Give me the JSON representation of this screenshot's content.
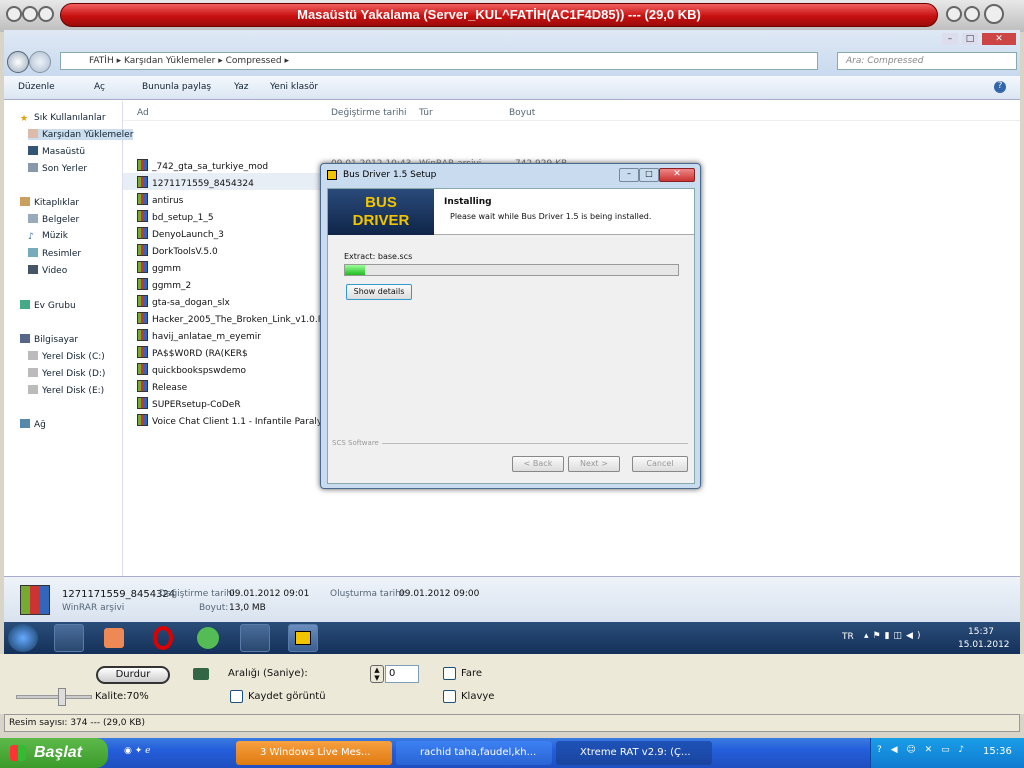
{
  "window": {
    "title": "Masaüstü Yakalama (Server_KUL^FATİH(AC1F4D85)) --- (29,0 KB)"
  },
  "explorer": {
    "breadcrumb": [
      "FATİH",
      "Karşıdan Yüklemeler",
      "Compressed"
    ],
    "search_placeholder": "Ara: Compressed",
    "toolbar": [
      "Düzenle",
      "Aç",
      "Bununla paylaş",
      "Yaz",
      "Yeni klasör"
    ],
    "sidebar": {
      "favorites_header": "Sık Kullanılanlar",
      "favorites": [
        "Karşıdan Yüklemeler",
        "Masaüstü",
        "Son Yerler"
      ],
      "libraries_header": "Kitaplıklar",
      "libraries": [
        "Belgeler",
        "Müzik",
        "Resimler",
        "Video"
      ],
      "homegroup": "Ev Grubu",
      "computer_header": "Bilgisayar",
      "drives": [
        "Yerel Disk (C:)",
        "Yerel Disk (D:)",
        "Yerel Disk (E:)"
      ],
      "network": "Ağ"
    },
    "columns": [
      "Ad",
      "Değiştirme tarihi",
      "Tür",
      "Boyut"
    ],
    "files": [
      {
        "name": "_742_gta_sa_turkiye_mod",
        "date": "09.01.2012 10:43",
        "type": "WinRAR arşivi",
        "size": "742.929 KB"
      },
      {
        "name": "1271171559_8454324",
        "date": "09.01.2012 09:01",
        "type": "WinRAR arşivi",
        "size": "13.345 KB"
      },
      {
        "name": "antirus"
      },
      {
        "name": "bd_setup_1_5"
      },
      {
        "name": "DenyoLaunch_3"
      },
      {
        "name": "DorkToolsV.5.0"
      },
      {
        "name": "ggmm"
      },
      {
        "name": "ggmm_2"
      },
      {
        "name": "gta-sa_dogan_slx"
      },
      {
        "name": "Hacker_2005_The_Broken_Link_v1.0.Retai..."
      },
      {
        "name": "havij_anlatae_m_eyemir"
      },
      {
        "name": "PA$$W0RD (RA(KER$"
      },
      {
        "name": "quickbookspswdemo"
      },
      {
        "name": "Release"
      },
      {
        "name": "SUPERsetup-CoDeR"
      },
      {
        "name": "Voice Chat Client 1.1 - Infantile Paralysiser"
      }
    ],
    "details": {
      "name": "1271171559_8454324",
      "type": "WinRAR arşivi",
      "modified_label": "Değiştirme tarihi:",
      "modified": "09.01.2012 09:01",
      "size_label": "Boyut:",
      "size": "13,0 MB",
      "created_label": "Oluşturma tarihi:",
      "created": "09.01.2012 09:00"
    },
    "clock": {
      "lang": "TR",
      "time": "15:37",
      "date": "15.01.2012"
    }
  },
  "dialog": {
    "title": "Bus Driver 1.5 Setup",
    "logo_line1": "BUS",
    "logo_line2": "DRIVER",
    "heading": "Installing",
    "subheading": "Please wait while Bus Driver 1.5 is being installed.",
    "extract": "Extract: base.scs",
    "progress": 0.06,
    "show_details": "Show details",
    "footer": "SCS Software",
    "back": "< Back",
    "next": "Next >",
    "cancel": "Cancel"
  },
  "controls": {
    "stop": "Durdur",
    "interval_label": "Aralığı (Saniye):",
    "interval_value": "0",
    "mouse": "Fare",
    "quality": "Kalite:70%",
    "save_image": "Kaydet görüntü",
    "keyboard": "Klavye",
    "status": "Resim sayısı: 374 --- (29,0 KB)"
  },
  "taskbar": {
    "start": "Başlat",
    "tasks": [
      "3 Windows Live Mes...",
      "rachid taha,faudel,kh...",
      "Xtreme RAT v2.9: (Ç..."
    ],
    "time": "15:36"
  }
}
